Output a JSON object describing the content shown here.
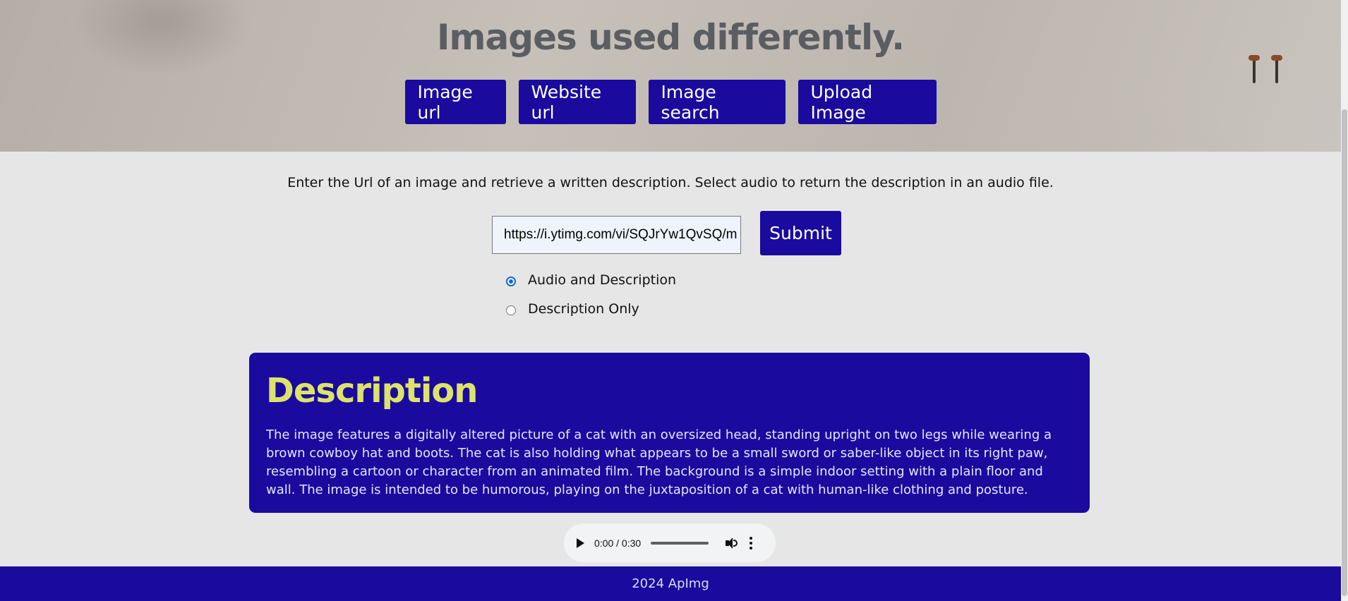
{
  "hero": {
    "title": "Images used differently.",
    "nav": [
      {
        "label": "Image url"
      },
      {
        "label": "Website url"
      },
      {
        "label": "Image search"
      },
      {
        "label": "Upload Image"
      }
    ]
  },
  "form": {
    "intro": "Enter the Url of an image and retrieve a written description. Select audio to return the description in an audio file.",
    "url_value": "https://i.ytimg.com/vi/SQJrYw1QvSQ/m",
    "submit_label": "Submit",
    "options": [
      {
        "label": "Audio and Description",
        "selected": true
      },
      {
        "label": "Description Only",
        "selected": false
      }
    ]
  },
  "description": {
    "title": "Description",
    "text": "The image features a digitally altered picture of a cat with an oversized head, standing upright on two legs while wearing a brown cowboy hat and boots. The cat is also holding what appears to be a small sword or saber-like object in its right paw, resembling a cartoon or character from an animated film. The background is a simple indoor setting with a plain floor and wall. The image is intended to be humorous, playing on the juxtaposition of a cat with human-like clothing and posture."
  },
  "audio": {
    "time": "0:00 / 0:30",
    "progress": 0
  },
  "footer": {
    "text": "2024 ApImg"
  },
  "colors": {
    "brand": "#1a0a9e",
    "accent": "#dde36a"
  }
}
